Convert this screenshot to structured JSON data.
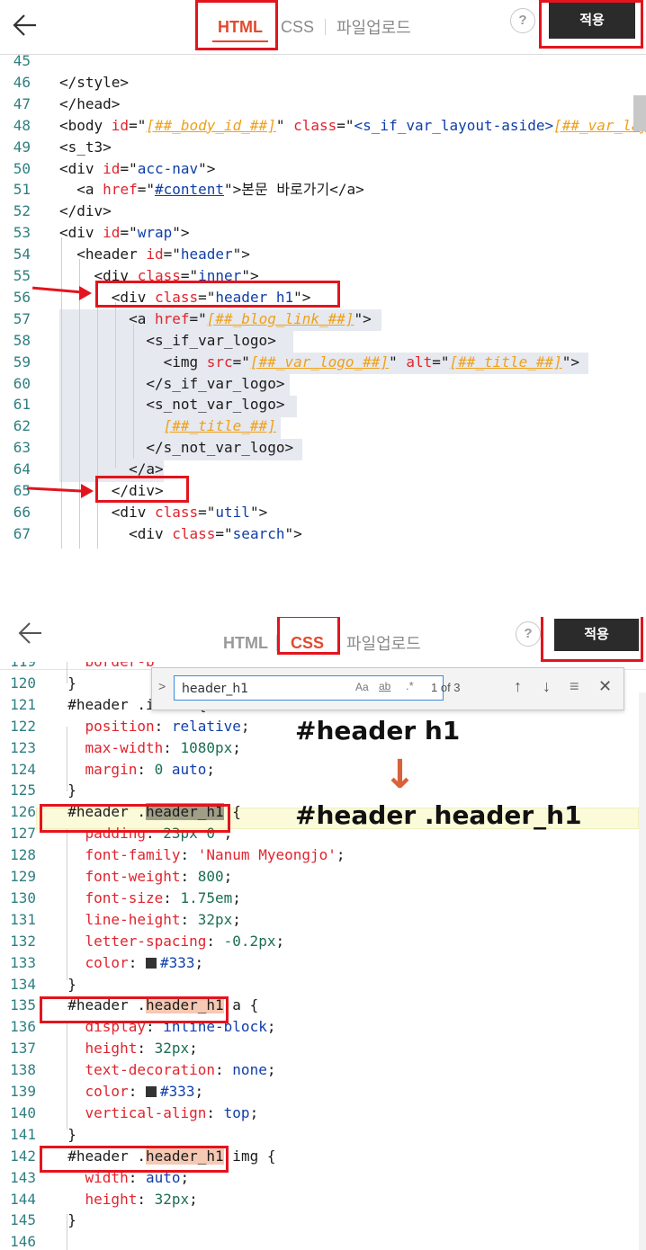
{
  "top": {
    "tabs": [
      {
        "label": "HTML"
      },
      {
        "label": "CSS"
      },
      {
        "label": "파일업로드"
      }
    ],
    "help": "?",
    "apply": "적용",
    "lines": [
      {
        "n": "45",
        "html": ""
      },
      {
        "n": "46",
        "html": "<span class='t'>&lt;/style&gt;</span>"
      },
      {
        "n": "47",
        "html": "<span class='t'>&lt;/head&gt;</span>"
      },
      {
        "n": "48",
        "html": "<span class='t'>&lt;body </span><span class='a'>id</span><span class='t'>=\"</span><span class='v'>[##_body_id_##]</span><span class='t'>\" </span><span class='a'>class</span><span class='t'>=\"</span><span class='s'>&lt;s_if_var_layout-aside&gt;</span><span class='v'>[##_var_layout</span>"
      },
      {
        "n": "49",
        "html": "<span class='t'>&lt;s_t3&gt;</span>"
      },
      {
        "n": "50",
        "html": "<span class='t'>&lt;div </span><span class='a'>id</span><span class='t'>=\"</span><span class='s'>acc-nav</span><span class='t'>\"&gt;</span>"
      },
      {
        "n": "51",
        "html": "<span class='t'>  &lt;a </span><span class='a'>href</span><span class='t'>=\"</span><span class='s' style='text-decoration:underline'>#content</span><span class='t'>\"&gt;본문 바로가기&lt;/a&gt;</span>"
      },
      {
        "n": "52",
        "html": "<span class='t'>&lt;/div&gt;</span>"
      },
      {
        "n": "53",
        "html": "<span class='t'>&lt;div </span><span class='a'>id</span><span class='t'>=\"</span><span class='s'>wrap</span><span class='t'>\"&gt;</span>"
      },
      {
        "n": "54",
        "html": "<span class='t'>  &lt;header </span><span class='a'>id</span><span class='t'>=\"</span><span class='s'>header</span><span class='t'>\"&gt;</span>"
      },
      {
        "n": "55",
        "html": "<span class='t'>    &lt;div </span><span class='a'>class</span><span class='t'>=\"</span><span class='s'>inner</span><span class='t'>\"&gt;</span>"
      },
      {
        "n": "56",
        "html": "<span class='t'>      &lt;div </span><span class='a'>class</span><span class='t'>=\"</span><span class='s'>header_h1</span><span class='t'>\"&gt;</span>"
      },
      {
        "n": "57",
        "html": "<span class='t'>        &lt;a </span><span class='a'>href</span><span class='t'>=\"</span><span class='v'>[##_blog_link_##]</span><span class='t'>\"&gt;</span>"
      },
      {
        "n": "58",
        "html": "<span class='t'>          &lt;s_if_var_logo&gt;</span>"
      },
      {
        "n": "59",
        "html": "<span class='t'>            &lt;img </span><span class='a'>src</span><span class='t'>=\"</span><span class='v'>[##_var_logo_##]</span><span class='t'>\" </span><span class='a'>alt</span><span class='t'>=\"</span><span class='v'>[##_title_##]</span><span class='t'>\"&gt;</span>"
      },
      {
        "n": "60",
        "html": "<span class='t'>          &lt;/s_if_var_logo&gt;</span>"
      },
      {
        "n": "61",
        "html": "<span class='t'>          &lt;s_not_var_logo&gt;</span>"
      },
      {
        "n": "62",
        "html": "<span class='t'>            </span><span class='v'>[##_title_##]</span>"
      },
      {
        "n": "63",
        "html": "<span class='t'>          &lt;/s_not_var_logo&gt;</span>"
      },
      {
        "n": "64",
        "html": "<span class='t'>        &lt;/a&gt;</span>"
      },
      {
        "n": "65",
        "html": "<span class='t'>      &lt;/div&gt;</span>"
      },
      {
        "n": "66",
        "html": "<span class='t'>      &lt;div </span><span class='a'>class</span><span class='t'>=\"</span><span class='s'>util</span><span class='t'>\"&gt;</span>"
      },
      {
        "n": "67",
        "html": "<span class='t'>        &lt;div </span><span class='a'>class</span><span class='t'>=\"</span><span class='s'>search</span><span class='t'>\"&gt;</span>"
      }
    ]
  },
  "bottom": {
    "tabs": [
      {
        "label": "HTML"
      },
      {
        "label": "CSS"
      },
      {
        "label": "파일업로드"
      }
    ],
    "help": "?",
    "apply": "적용",
    "find": {
      "value": "header_h1",
      "case": "Aa",
      "word": "ab",
      "regex": ".*",
      "count": "1 of 3"
    },
    "annotation_top": "#header h1",
    "annotation_arrow": "↓",
    "annotation_bottom": "#header .header_h1",
    "lines": [
      {
        "n": "119",
        "html": "<span class='prop'>    border-b</span>"
      },
      {
        "n": "120",
        "html": "<span class='t'>  }</span>"
      },
      {
        "n": "121",
        "html": "<span class='t'>  #header .inner {</span>"
      },
      {
        "n": "122",
        "html": "<span class='prop'>    position</span><span class='t'>: </span><span class='val'>relative</span><span class='t'>;</span>"
      },
      {
        "n": "123",
        "html": "<span class='prop'>    max-width</span><span class='t'>: </span><span class='num'>1080px</span><span class='t'>;</span>"
      },
      {
        "n": "124",
        "html": "<span class='prop'>    margin</span><span class='t'>: </span><span class='num'>0</span><span class='t'> </span><span class='val'>auto</span><span class='t'>;</span>"
      },
      {
        "n": "125",
        "html": "<span class='t'>  }</span>"
      },
      {
        "n": "126",
        "html": "<span class='t'>  #header .</span><span class='t' style='background:#9f9f87'>header_h1</span><span class='t'> {</span>"
      },
      {
        "n": "127",
        "html": "<span class='prop'>    padding</span><span class='t'>: </span><span class='num'>23px</span><span class='t'> </span><span class='num'>0</span><span class='t'> ;</span>"
      },
      {
        "n": "128",
        "html": "<span class='prop'>    font-family</span><span class='t'>: </span><span class='a'>'Nanum Myeongjo'</span><span class='t'>;</span>"
      },
      {
        "n": "129",
        "html": "<span class='prop'>    font-weight</span><span class='t'>: </span><span class='num'>800</span><span class='t'>;</span>"
      },
      {
        "n": "130",
        "html": "<span class='prop'>    font-size</span><span class='t'>: </span><span class='num'>1.75em</span><span class='t'>;</span>"
      },
      {
        "n": "131",
        "html": "<span class='prop'>    line-height</span><span class='t'>: </span><span class='num'>32px</span><span class='t'>;</span>"
      },
      {
        "n": "132",
        "html": "<span class='prop'>    letter-spacing</span><span class='t'>: </span><span class='num'>-0.2px</span><span class='t'>;</span>"
      },
      {
        "n": "133",
        "html": "<span class='prop'>    color</span><span class='t'>: </span><span class='t' style='display:inline-block;width:12px;height:12px;background:#333;vertical-align:-1px;margin-right:4px'></span><span class='s'>#333</span><span class='t'>;</span>"
      },
      {
        "n": "134",
        "html": "<span class='t'>  }</span>"
      },
      {
        "n": "135",
        "html": "<span class='t'>  #header .</span><span class='t' style='background:#f5c9b3'>header_h1</span><span class='t'> a {</span>"
      },
      {
        "n": "136",
        "html": "<span class='prop'>    display</span><span class='t'>: </span><span class='val'>inline-block</span><span class='t'>;</span>"
      },
      {
        "n": "137",
        "html": "<span class='prop'>    height</span><span class='t'>: </span><span class='num'>32px</span><span class='t'>;</span>"
      },
      {
        "n": "138",
        "html": "<span class='prop'>    text-decoration</span><span class='t'>: </span><span class='val'>none</span><span class='t'>;</span>"
      },
      {
        "n": "139",
        "html": "<span class='prop'>    color</span><span class='t'>: </span><span class='t' style='display:inline-block;width:12px;height:12px;background:#333;vertical-align:-1px;margin-right:4px'></span><span class='s'>#333</span><span class='t'>;</span>"
      },
      {
        "n": "140",
        "html": "<span class='prop'>    vertical-align</span><span class='t'>: </span><span class='val'>top</span><span class='t'>;</span>"
      },
      {
        "n": "141",
        "html": "<span class='t'>  }</span>"
      },
      {
        "n": "142",
        "html": "<span class='t'>  #header .</span><span class='t' style='background:#f5c9b3'>header_h1</span><span class='t'> img {</span>"
      },
      {
        "n": "143",
        "html": "<span class='prop'>    width</span><span class='t'>: </span><span class='val'>auto</span><span class='t'>;</span>"
      },
      {
        "n": "144",
        "html": "<span class='prop'>    height</span><span class='t'>: </span><span class='num'>32px</span><span class='t'>;</span>"
      },
      {
        "n": "145",
        "html": "<span class='t'>  }</span>"
      },
      {
        "n": "146",
        "html": ""
      }
    ]
  }
}
